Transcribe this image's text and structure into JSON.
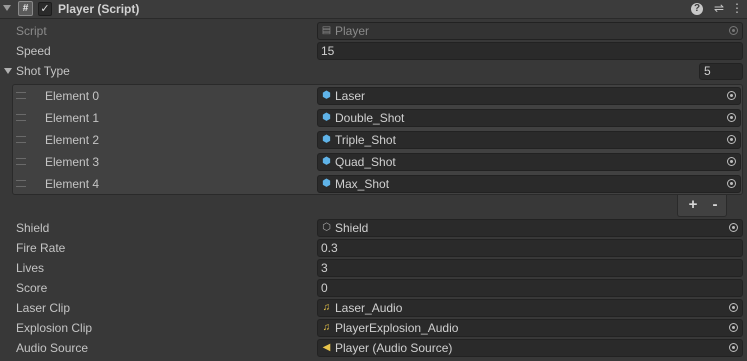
{
  "header": {
    "title": "Player (Script)",
    "enabled": true,
    "icons": [
      "hash-icon",
      "help-icon",
      "presets-icon",
      "more-icon"
    ]
  },
  "script": {
    "label": "Script",
    "value": "Player"
  },
  "speed": {
    "label": "Speed",
    "value": "15"
  },
  "shot_type": {
    "label": "Shot Type",
    "size": "5",
    "elements": [
      {
        "label": "Element 0",
        "value": "Laser"
      },
      {
        "label": "Element 1",
        "value": "Double_Shot"
      },
      {
        "label": "Element 2",
        "value": "Triple_Shot"
      },
      {
        "label": "Element 3",
        "value": "Quad_Shot"
      },
      {
        "label": "Element 4",
        "value": "Max_Shot"
      }
    ],
    "add_label": "+",
    "remove_label": "-"
  },
  "shield": {
    "label": "Shield",
    "value": "Shield"
  },
  "fire_rate": {
    "label": "Fire Rate",
    "value": "0.3"
  },
  "lives": {
    "label": "Lives",
    "value": "3"
  },
  "score": {
    "label": "Score",
    "value": "0"
  },
  "laser_clip": {
    "label": "Laser Clip",
    "value": "Laser_Audio"
  },
  "explosion_clip": {
    "label": "Explosion Clip",
    "value": "PlayerExplosion_Audio"
  },
  "audio_source": {
    "label": "Audio Source",
    "value": "Player (Audio Source)"
  },
  "colors": {
    "background": "#383838",
    "field": "#2a2a2a",
    "prefab_icon": "#5fb3e8",
    "audio_icon": "#e8c44a"
  }
}
